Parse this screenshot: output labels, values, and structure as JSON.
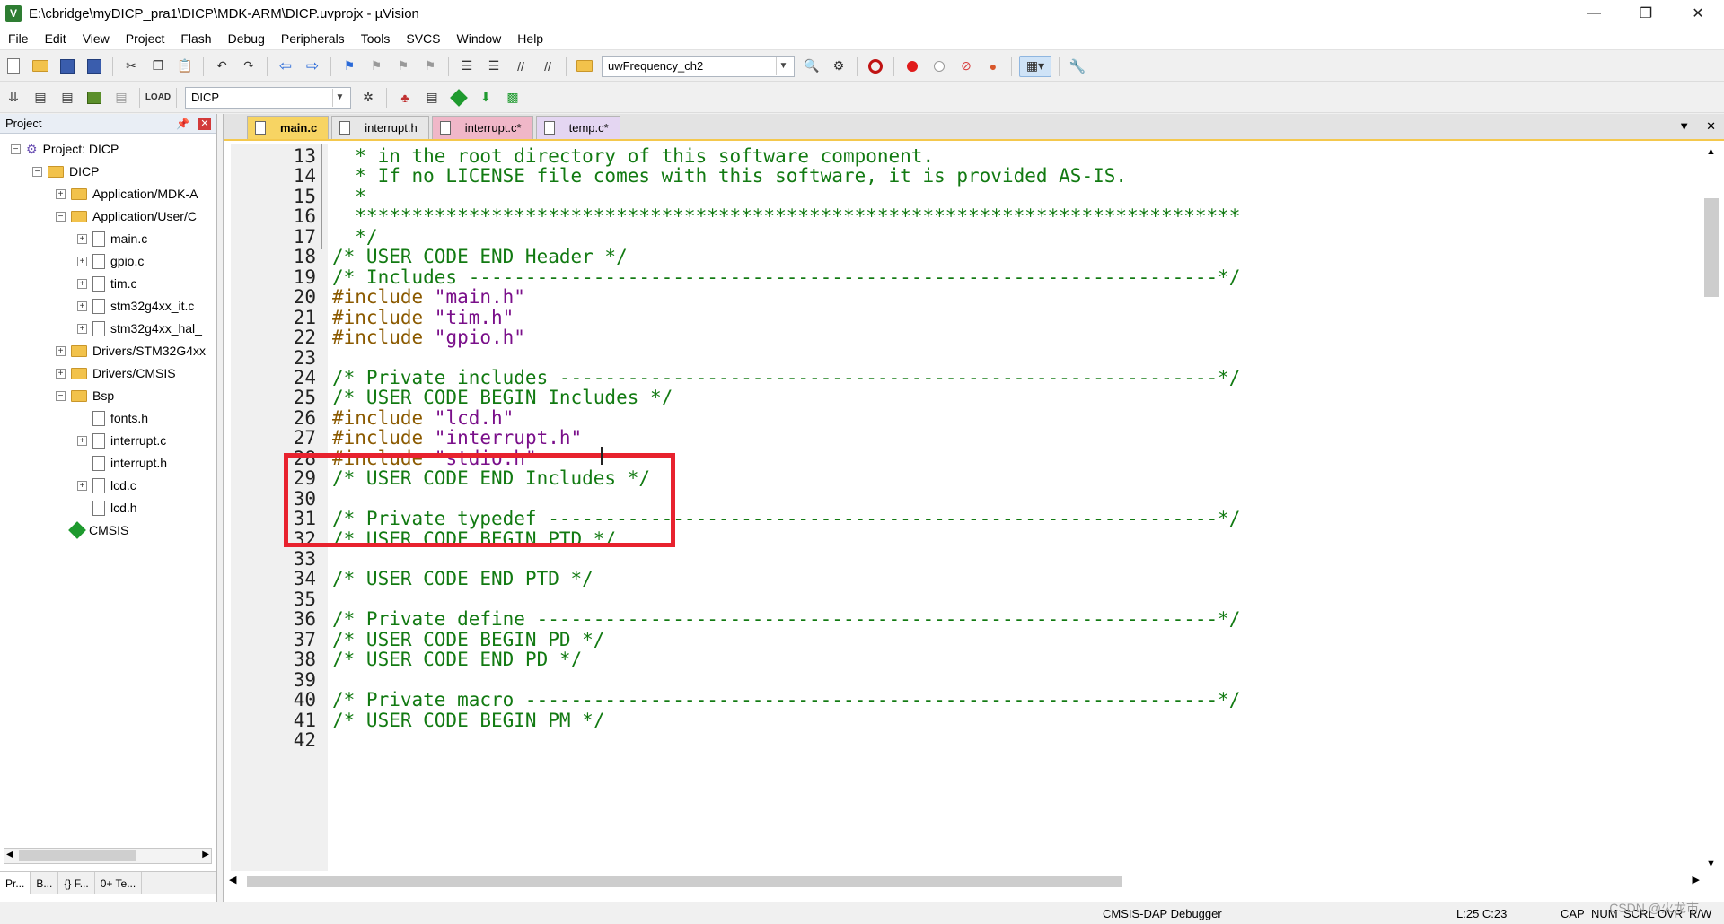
{
  "window": {
    "title": "E:\\cbridge\\myDICP_pra1\\DICP\\MDK-ARM\\DICP.uvprojx - µVision",
    "controls": [
      "—",
      "❐",
      "✕"
    ]
  },
  "menu": [
    "File",
    "Edit",
    "View",
    "Project",
    "Flash",
    "Debug",
    "Peripherals",
    "Tools",
    "SVCS",
    "Window",
    "Help"
  ],
  "toolbar": {
    "find_combo": "uwFrequency_ch2",
    "target_combo": "DICP"
  },
  "project": {
    "title": "Project",
    "tree": [
      {
        "label": "Project: DICP",
        "exp": "−"
      },
      {
        "label": "DICP",
        "exp": "−"
      },
      {
        "label": "Application/MDK-A",
        "exp": "+"
      },
      {
        "label": "Application/User/C",
        "exp": "−"
      },
      {
        "label": "main.c",
        "exp": "+"
      },
      {
        "label": "gpio.c",
        "exp": "+"
      },
      {
        "label": "tim.c",
        "exp": "+"
      },
      {
        "label": "stm32g4xx_it.c",
        "exp": "+"
      },
      {
        "label": "stm32g4xx_hal_",
        "exp": "+"
      },
      {
        "label": "Drivers/STM32G4xx",
        "exp": "+"
      },
      {
        "label": "Drivers/CMSIS",
        "exp": "+"
      },
      {
        "label": "Bsp",
        "exp": "−"
      },
      {
        "label": "fonts.h",
        "exp": ""
      },
      {
        "label": "interrupt.c",
        "exp": "+"
      },
      {
        "label": "interrupt.h",
        "exp": ""
      },
      {
        "label": "lcd.c",
        "exp": "+"
      },
      {
        "label": "lcd.h",
        "exp": ""
      },
      {
        "label": "CMSIS",
        "exp": ""
      }
    ],
    "bottom_tabs": [
      "Pr...",
      "B...",
      "{} F...",
      "0+ Te..."
    ]
  },
  "tabs": [
    {
      "label": "main.c",
      "state": "active"
    },
    {
      "label": "interrupt.h",
      "state": "normal"
    },
    {
      "label": "interrupt.c*",
      "state": "modified"
    },
    {
      "label": "temp.c*",
      "state": "temp"
    }
  ],
  "code_lines": [
    {
      "n": "13",
      "parts": [
        {
          "t": "  * in the root directory of this software component.",
          "c": "cmt"
        }
      ]
    },
    {
      "n": "14",
      "parts": [
        {
          "t": "  * If no LICENSE file comes with this software, it is provided AS-IS.",
          "c": "cmt"
        }
      ]
    },
    {
      "n": "15",
      "parts": [
        {
          "t": "  *",
          "c": "cmt"
        }
      ]
    },
    {
      "n": "16",
      "parts": [
        {
          "t": "  ******************************************************************************",
          "c": "cmt"
        }
      ]
    },
    {
      "n": "17",
      "parts": [
        {
          "t": "  */",
          "c": "cmt"
        }
      ]
    },
    {
      "n": "18",
      "parts": [
        {
          "t": "/* USER CODE END Header */",
          "c": "cmt"
        }
      ]
    },
    {
      "n": "19",
      "parts": [
        {
          "t": "/* Includes ------------------------------------------------------------------*/",
          "c": "cmt"
        }
      ]
    },
    {
      "n": "20",
      "parts": [
        {
          "t": "#include ",
          "c": "pp"
        },
        {
          "t": "\"main.h\"",
          "c": "str"
        }
      ]
    },
    {
      "n": "21",
      "parts": [
        {
          "t": "#include ",
          "c": "pp"
        },
        {
          "t": "\"tim.h\"",
          "c": "str"
        }
      ]
    },
    {
      "n": "22",
      "parts": [
        {
          "t": "#include ",
          "c": "pp"
        },
        {
          "t": "\"gpio.h\"",
          "c": "str"
        }
      ]
    },
    {
      "n": "23",
      "parts": []
    },
    {
      "n": "24",
      "parts": [
        {
          "t": "/* Private includes ----------------------------------------------------------*/",
          "c": "cmt"
        }
      ]
    },
    {
      "n": "25",
      "parts": [
        {
          "t": "/* USER CODE BEGIN Includes */",
          "c": "cmt"
        }
      ]
    },
    {
      "n": "26",
      "parts": [
        {
          "t": "#include ",
          "c": "pp"
        },
        {
          "t": "\"lcd.h\"",
          "c": "str"
        }
      ]
    },
    {
      "n": "27",
      "parts": [
        {
          "t": "#include ",
          "c": "pp"
        },
        {
          "t": "\"interrupt.h\"",
          "c": "str"
        }
      ]
    },
    {
      "n": "28",
      "parts": [
        {
          "t": "#include ",
          "c": "pp"
        },
        {
          "t": "\"stdio.h\"",
          "c": "str"
        }
      ]
    },
    {
      "n": "29",
      "parts": [
        {
          "t": "/* USER CODE END Includes */",
          "c": "cmt"
        }
      ]
    },
    {
      "n": "30",
      "parts": []
    },
    {
      "n": "31",
      "parts": [
        {
          "t": "/* Private typedef -----------------------------------------------------------*/",
          "c": "cmt"
        }
      ]
    },
    {
      "n": "32",
      "parts": [
        {
          "t": "/* USER CODE BEGIN PTD */",
          "c": "cmt"
        }
      ]
    },
    {
      "n": "33",
      "parts": []
    },
    {
      "n": "34",
      "parts": [
        {
          "t": "/* USER CODE END PTD */",
          "c": "cmt"
        }
      ]
    },
    {
      "n": "35",
      "parts": []
    },
    {
      "n": "36",
      "parts": [
        {
          "t": "/* Private define ------------------------------------------------------------*/",
          "c": "cmt"
        }
      ]
    },
    {
      "n": "37",
      "parts": [
        {
          "t": "/* USER CODE BEGIN PD */",
          "c": "cmt"
        }
      ]
    },
    {
      "n": "38",
      "parts": [
        {
          "t": "/* USER CODE END PD */",
          "c": "cmt"
        }
      ]
    },
    {
      "n": "39",
      "parts": []
    },
    {
      "n": "40",
      "parts": [
        {
          "t": "/* Private macro -------------------------------------------------------------*/",
          "c": "cmt"
        }
      ]
    },
    {
      "n": "41",
      "parts": [
        {
          "t": "/* USER CODE BEGIN PM */",
          "c": "cmt"
        }
      ]
    },
    {
      "n": "42",
      "parts": []
    }
  ],
  "colors": {
    "comment": "#127a12",
    "preprocessor": "#8b5a00",
    "string": "#7a0f8a",
    "highlight_box": "#e8222e",
    "active_tab": "#f7d463"
  },
  "status": {
    "debugger": "CMSIS-DAP Debugger",
    "position": "L:25 C:23",
    "cap": "CAP",
    "num": "NUM",
    "scrl": "SCRL",
    "ovr": "OVR",
    "rw": "R/W"
  },
  "watermark": "CSDN @火龙市"
}
